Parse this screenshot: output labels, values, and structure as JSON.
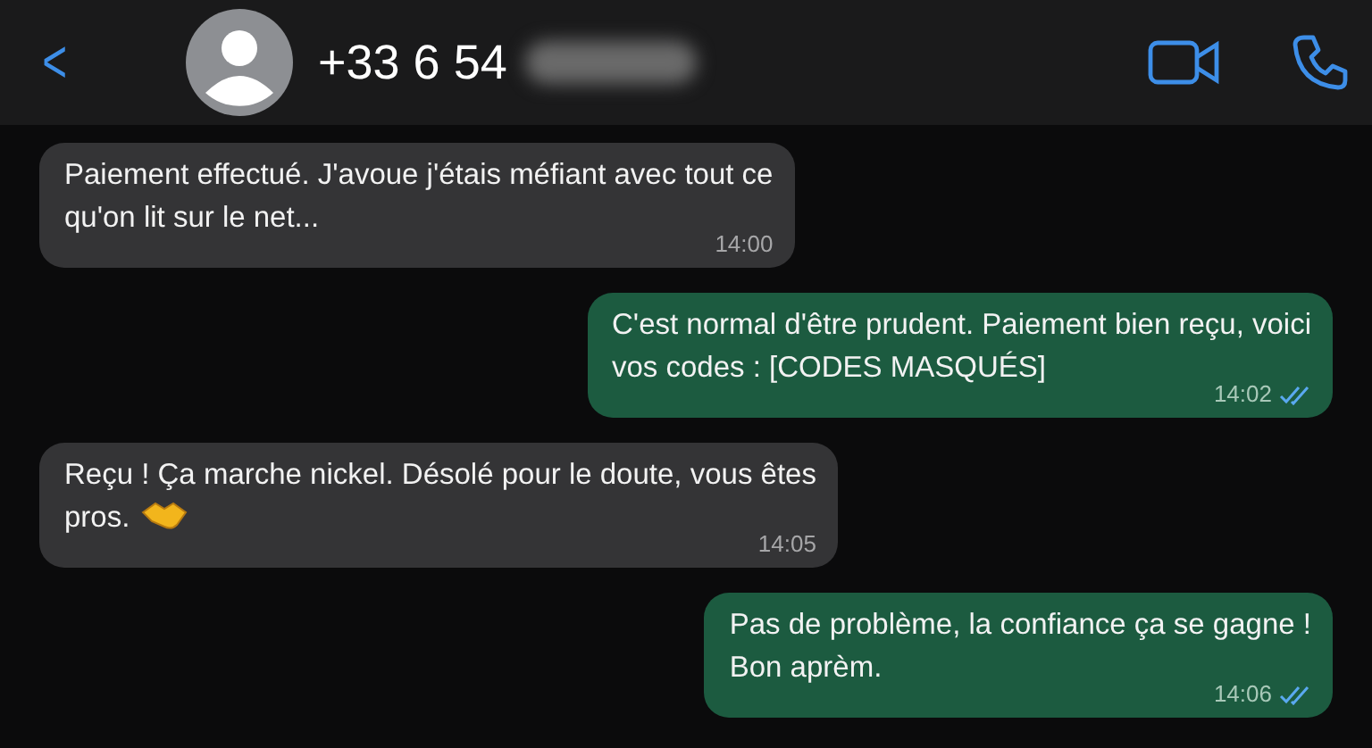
{
  "header": {
    "back": "<",
    "contact": "+33 6 54",
    "number_hidden": true
  },
  "messages": [
    {
      "kind": "incoming",
      "text": "Paiement effectué. J'avoue j'étais méfiant avec tout ce\nqu'on lit sur le net...",
      "time": "14:00"
    },
    {
      "kind": "outgoing",
      "text": "C'est normal d'être prudent. Paiement bien reçu, voici\nvos codes : [CODES MASQUÉS]",
      "time": "14:02",
      "read": true
    },
    {
      "kind": "incoming",
      "text": "Reçu ! Ça marche nickel. Désolé pour le doute, vous êtes\npros.",
      "time": "14:05",
      "emoji": true
    },
    {
      "kind": "outgoing",
      "text": "Pas de problème, la confiance ça se gagne !\nBon aprèm.",
      "time": "14:06",
      "read": true
    }
  ]
}
